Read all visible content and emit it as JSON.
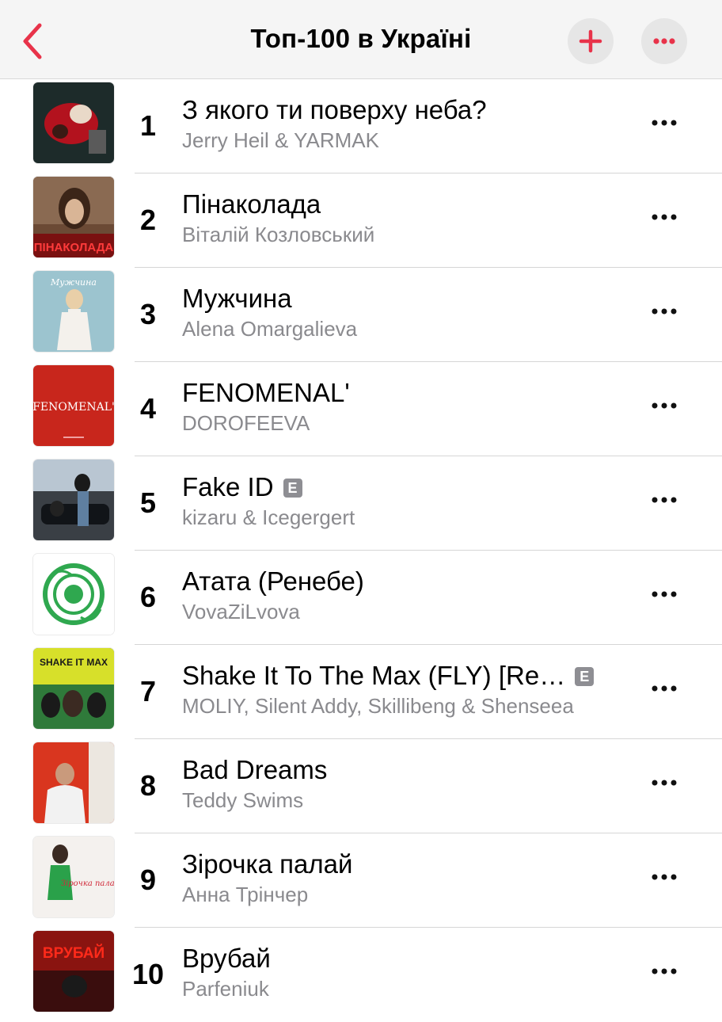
{
  "header": {
    "title": "Топ-100 в Україні"
  },
  "colors": {
    "accent": "#e8334a",
    "secondary_text": "#8a8a8e",
    "explicit_badge": "#8e8e93"
  },
  "icons": {
    "back": "chevron-left-icon",
    "add": "plus-icon",
    "more": "ellipsis-icon",
    "explicit": "explicit-badge"
  },
  "songs": [
    {
      "rank": "1",
      "title": "З якого ти поверху неба?",
      "artist": "Jerry Heil & YARMAK",
      "explicit": false
    },
    {
      "rank": "2",
      "title": "Пінаколада",
      "artist": "Віталій Козловський",
      "explicit": false,
      "art_text": "ПІНАКОЛАДА"
    },
    {
      "rank": "3",
      "title": "Мужчина",
      "artist": "Alena Omargalieva",
      "explicit": false,
      "art_text": "Мужчина"
    },
    {
      "rank": "4",
      "title": "FENOMENAL'",
      "artist": "DOROFEEVA",
      "explicit": false,
      "art_text": "FENOMENAL'"
    },
    {
      "rank": "5",
      "title": "Fake ID",
      "artist": "kizaru & Icegergert",
      "explicit": true
    },
    {
      "rank": "6",
      "title": "Атата (Ренебе)",
      "artist": "VovaZiLvova",
      "explicit": false
    },
    {
      "rank": "7",
      "title": "Shake It To The Max (FLY) [Re…",
      "artist": "MOLIY, Silent Addy, Skillibeng & Shenseea",
      "explicit": true,
      "art_text": "SHAKE IT MAX"
    },
    {
      "rank": "8",
      "title": "Bad Dreams",
      "artist": "Teddy Swims",
      "explicit": false
    },
    {
      "rank": "9",
      "title": "Зірочка палай",
      "artist": "Анна Трінчер",
      "explicit": false,
      "art_text": "Зірочка палай!"
    },
    {
      "rank": "10",
      "title": "Врубай",
      "artist": "Parfeniuk",
      "explicit": false,
      "art_text": "ВРУБАЙ"
    }
  ],
  "explicit_label": "E"
}
